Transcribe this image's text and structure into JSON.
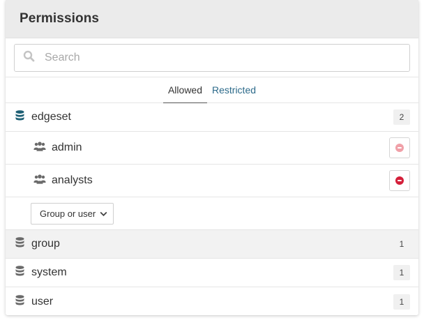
{
  "header": {
    "title": "Permissions"
  },
  "search": {
    "placeholder": "Search",
    "value": ""
  },
  "tabs": [
    {
      "label": "Allowed",
      "active": true
    },
    {
      "label": "Restricted",
      "active": false
    }
  ],
  "databases": [
    {
      "name": "edgeset",
      "count": "2",
      "expanded": true,
      "members": [
        {
          "name": "admin",
          "remove_state": "disabled"
        },
        {
          "name": "analysts",
          "remove_state": "enabled"
        }
      ],
      "add_select_label": "Group or user"
    },
    {
      "name": "group",
      "count": "1",
      "highlighted": true
    },
    {
      "name": "system",
      "count": "1"
    },
    {
      "name": "user",
      "count": "1"
    }
  ],
  "colors": {
    "accent": "#2c6a8a",
    "db_icon_active": "#1d5f74",
    "db_icon_default": "#6a6a6a",
    "remove_disabled": "#f0a0a8",
    "remove_enabled": "#d41f3a"
  },
  "icons": {
    "search": "search-icon",
    "database": "database-icon",
    "group": "users-icon",
    "dropdown": "chevron-down-icon",
    "remove": "remove-circle-icon"
  }
}
